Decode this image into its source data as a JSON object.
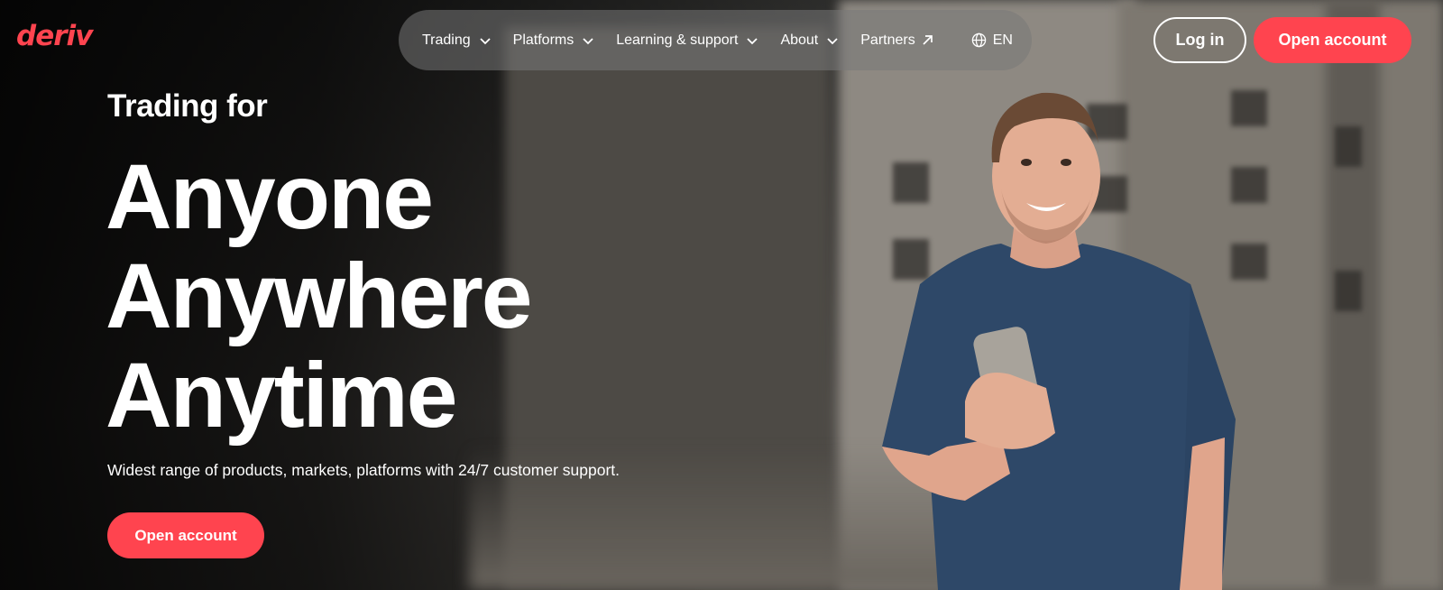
{
  "brand": {
    "logo_text": "deriv",
    "accent": "#ff444f"
  },
  "nav": {
    "items": [
      {
        "label": "Trading",
        "icon": "chevron-down-icon"
      },
      {
        "label": "Platforms",
        "icon": "chevron-down-icon"
      },
      {
        "label": "Learning & support",
        "icon": "chevron-down-icon"
      },
      {
        "label": "About",
        "icon": "chevron-down-icon"
      },
      {
        "label": "Partners",
        "icon": "external-arrow-icon"
      }
    ],
    "language": {
      "label": "EN",
      "icon": "globe-icon"
    }
  },
  "header_actions": {
    "login_label": "Log in",
    "open_account_label": "Open account"
  },
  "hero": {
    "subtitle": "Trading for",
    "headline_lines": [
      "Anyone",
      "Anywhere",
      "Anytime"
    ],
    "tagline": "Widest range of products, markets, platforms with 24/7 customer support.",
    "cta_label": "Open account"
  }
}
